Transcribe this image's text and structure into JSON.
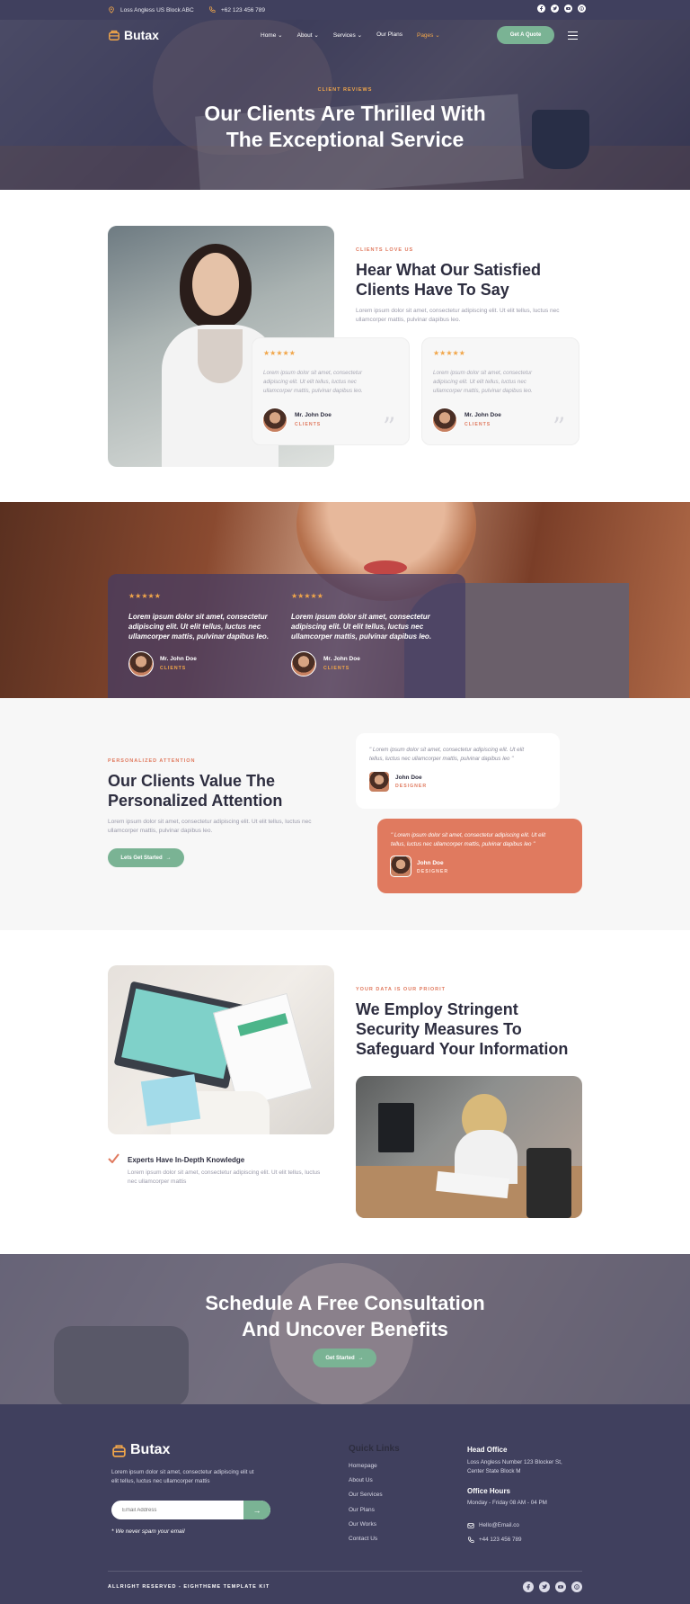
{
  "topbar": {
    "address": "Loss Angless US Block ABC",
    "phone": "+62 123 456 789"
  },
  "brand": {
    "name": "Butax"
  },
  "nav": {
    "items": [
      {
        "label": "Home",
        "dropdown": true
      },
      {
        "label": "About",
        "dropdown": true
      },
      {
        "label": "Services",
        "dropdown": true
      },
      {
        "label": "Our Plans",
        "dropdown": false
      },
      {
        "label": "Pages",
        "dropdown": true
      }
    ],
    "quote_button": "Get A Quote"
  },
  "hero": {
    "eyebrow": "CLIENT REVIEWS",
    "title_line1": "Our Clients Are Thrilled With",
    "title_line2": "The Exceptional Service"
  },
  "satisfied": {
    "eyebrow": "CLIENTS LOVE US",
    "title_line1": "Hear What Our Satisfied",
    "title_line2": "Clients Have To Say",
    "para_line1": "Lorem ipsum dolor sit amet, consectetur adipiscing elit. Ut elit tellus, luctus nec",
    "para_line2": "ullamcorper mattis, pulvinar dapibus leo.",
    "cards": [
      {
        "stars": "★★★★★",
        "q1": "Lorem ipsum dolor sit amet, consectetur",
        "q2": "adipiscing elit. Ut elit tellus, luctus nec",
        "q3": "ullamcorper mattis, pulvinar dapibus leo.",
        "name": "Mr. John Doe",
        "role": "CLIENTS"
      },
      {
        "stars": "★★★★★",
        "q1": "Lorem ipsum dolor sit amet, consectetur",
        "q2": "adipiscing elit. Ut elit tellus, luctus nec",
        "q3": "ullamcorper mattis, pulvinar dapibus leo.",
        "name": "Mr. John Doe",
        "role": "CLIENTS"
      }
    ]
  },
  "band": {
    "cards": [
      {
        "stars": "★★★★★",
        "q1": "Lorem ipsum dolor sit amet, consectetur",
        "q2": "adipiscing elit. Ut elit tellus, luctus nec",
        "q3": "ullamcorper mattis, pulvinar dapibus leo.",
        "name": "Mr. John Doe",
        "role": "CLIENTS"
      },
      {
        "stars": "★★★★★",
        "q1": "Lorem ipsum dolor sit amet, consectetur",
        "q2": "adipiscing elit. Ut elit tellus, luctus nec",
        "q3": "ullamcorper mattis, pulvinar dapibus leo.",
        "name": "Mr. John Doe",
        "role": "CLIENTS"
      }
    ]
  },
  "attention": {
    "eyebrow": "PERSONALIZED ATTENTION",
    "title_line1": "Our Clients Value The",
    "title_line2": "Personalized Attention",
    "para_line1": "Lorem ipsum dolor sit amet, consectetur adipiscing elit. Ut elit tellus, luctus nec",
    "para_line2": "ullamcorper mattis, pulvinar dapibus leo.",
    "button": "Lets Get Started",
    "quotes": [
      {
        "l1": "\" Lorem ipsum dolor sit amet, consectetur adipiscing elit. Ut elit",
        "l2": "tellus, luctus nec ullamcorper mattis, pulvinar dapibus leo \"",
        "name": "John Doe",
        "role": "DESIGNER"
      },
      {
        "l1": "\" Lorem ipsum dolor sit amet, consectetur adipiscing elit. Ut elit",
        "l2": "tellus, luctus nec ullamcorper mattis, pulvinar dapibus leo \"",
        "name": "John Doe",
        "role": "DESIGNER"
      }
    ]
  },
  "security": {
    "eyebrow": "YOUR DATA IS OUR PRIORIT",
    "title_line1": "We Employ Stringent",
    "title_line2": "Security Measures To",
    "title_line3": "Safeguard Your Information",
    "feature_title": "Experts Have In-Depth Knowledge",
    "feature_line1": "Lorem ipsum dolor sit amet, consectetur adipiscing elit. Ut elit tellus, luctus",
    "feature_line2": "nec ullamcorper mattis"
  },
  "cta": {
    "title_line1": "Schedule A Free Consultation",
    "title_line2": "And Uncover Benefits",
    "button": "Get Started"
  },
  "footer": {
    "brand": "Butax",
    "about_line1": "Lorem ipsum dolor sit amet, consectetur adipiscing elit ut",
    "about_line2": "elit tellus, luctus nec ullamcorper mattis",
    "email_placeholder": "Email Address",
    "spam_note": "* We never spam your email",
    "quick_links_title": "Quick Links",
    "quick_links": [
      "Homepage",
      "About Us",
      "Our Services",
      "Our Plans",
      "Our Works",
      "Contact Us"
    ],
    "head_office_title": "Head Office",
    "head_office_line1": "Loss Angless Number 123 Blocker St,",
    "head_office_line2": "Center State Block M",
    "hours_title": "Office Hours",
    "hours": "Monday - Friday 08 AM - 04 PM",
    "email": "Hello@Email.co",
    "phone": "+44 123 456 789",
    "copyright": "ALLRIGHT RESERVED - EIGHTHEME TEMPLATE KIT"
  },
  "colors": {
    "navy": "#40405e",
    "accent_orange": "#e07a5f",
    "accent_gold": "#f1a64a",
    "accent_green": "#7ab394"
  }
}
